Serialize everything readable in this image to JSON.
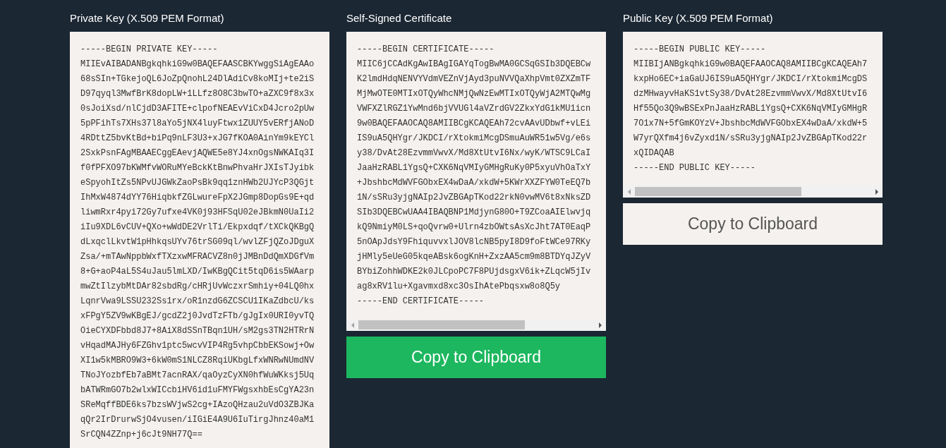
{
  "panels": [
    {
      "title": "Private Key (X.509 PEM Format)",
      "lines": [
        "-----BEGIN PRIVATE KEY-----",
        "MIIEvAIBADANBgkqhkiG9w0BAQEFAASCBKYwggSiAgEAAo",
        "68sSIn+TGkejoQL6JoZpQnohL24DlAdiCv8koMIj+te2iS",
        "D97qyql3MwfBrK8dopLW+1LLfz8O8C3bwTO+aZXC9f8x3x",
        "0sJoiXsd/nlCjdD3AFITE+clpofNEAEvViCxD4Jcro2pUw",
        "5pPFihTs7XHs37l8aYo5jNX4luyFtwx1ZUUY5vERfjANoD",
        "4RDttZ5bvKtBd+biPq9nLF3U3+xJG7fKOA0AinYm9kEYCl",
        "2SxkPsnFAgMBAAECggEAevjAQWE5e8YJ4xnOgsNWKAIq3I",
        "f0fPFXO97bKWMfvWORuMYeBckKtBnwPhvaHrJXIsTJyibk",
        "eSpyohItZs5NPvUJGWkZaoPsBk9qq1znHWb2UJYcP3QGjt",
        "IhMxW4874dYY76HiqbkfZGLwureFpX2JGmp8DopGs9E+qd",
        "liwmRxr4pyi72Gy7ufxe4VK0j93HFSqU02eJBkmN0UaIi2",
        "iIu9XDL6vCUV+QXo+wWdDE2VrlTi/Ekpxdqf/tXCkQKBgQ",
        "dLxqclLkvtW1pHhkqsUYv76trSG09ql/wvlZFjQZoJDguX",
        "Zsa/+mTAwNppbWxfTXzxwMFRACVZ8n0jJMBnDdQmXDGfVm",
        "8+G+aoP4aL5S4uJau5lmLXD/IwKBgQCit5tqD6is5WAarp",
        "mwZtIlzybMtDAr82sbdRg/cHRjUvWczxrSmhiy+04LQ0hx",
        "LqnrVwa9LSSU232Ss1rx/oR1nzdG6ZCSCU1IKaZdbcU/ks",
        "xFPgY5ZV9wKBgEJ/gcdZ2j0JvdTzFTb/gJgIx0URI0yvTQ",
        "OieCYXDFbbd8J7+8AiX8dSSnTBqn1UH/sM2gs3TN2HTRrN",
        "vHqadMAJHy6FZGhv1ptc5wcvVIP4Rg5vhpCbbEKSowj+Ow",
        "XI1w5kMBRO9W3+6kW0mS1NLCZ8RqiUKbgLfxWNRwNUmdNV",
        "TNoJYozbfEb7aBMt7acnRAX/qaOyzCyXN0hfWuWKksj5Uq",
        "bATWRmGO7b2wlxWICcbiHV6id1uFMYFWgsxhbEsCgYA23n",
        "SReMqffBDE6ks7bzsWVjwS2cg+IAzoQHzau2uVdO3ZBJKa",
        "qQr2IrDrurwSjO4vusen/iIGiE4A9U6IuTirgJhnz40aM1",
        "SrCQN4ZZnp+j6cJt9NH77Q=="
      ]
    },
    {
      "title": "Self-Signed Certificate",
      "horizontal_scrollbar": true,
      "lines": [
        "-----BEGIN CERTIFICATE-----",
        "MIIC6jCCAdKgAwIBAgIGAYqTogBwMA0GCSqGSIb3DQEBCw",
        "K2lmdHdqNENVYVdmVEZnVjAyd3puNVVQaXhpVmt0ZXZmTF",
        "MjMwOTE0MTIxOTQyWhcNMjQwNzEwMTIxOTQyWjA2MTQwMg",
        "VWFXZlRGZ1YwMnd6bjVVUGl4aVZrdGV2ZkxYdG1kMU1icn",
        "9w0BAQEFAAOCAQ8AMIIBCgKCAQEAh72cvAAvUDbwf+vLEi",
        "IS9uA5QHYgr/JKDCI/rXtokmiMcgDSmuAuWR51w5Vg/e6s",
        "y38/DvAt28EzvmmVwvX/Md8XtUtvI6Nx/wyK/WTSC9LCaI",
        "JaaHzRABL1YgsQ+CXK6NqVMIyGMHgRuKy0P5xyuVhOaTxY",
        "+JbshbcMdWVFGObxEX4wDaA/xkdW+5KWrXXZFYW0TeEQ7b",
        "1N/sSRu3yjgNAIp2JvZBGApTKod22rkN0vwMV6t8xNksZD",
        "SIb3DQEBCwUAA4IBAQBNP1MdjynG80O+T9ZCoaAIElwvjq",
        "kQ9NmiyM0LS+qoQvrw0+Ulrn4zbOWtsAsXcJht7AT0EaqP",
        "5nOApJdsY9FhiquvvxlJOV8lcNB5pyI8D9foFtWCe97RKy",
        "jHMly5eUeG05kqeABsk6ogKnH+ZxzAA5cm9m8BTDYqJZyV",
        "BYbiZohhWDKE2k0JLCpoPC7F8PUjdsgxV6ik+ZLqcW5jIv",
        "ag8xRV1lu+Xgavmxd8xc3OsIhAtePbqsxw8o8Q5y",
        "-----END CERTIFICATE-----"
      ],
      "button": {
        "label": "Copy to Clipboard",
        "primary": true
      }
    },
    {
      "title": "Public Key (X.509 PEM Format)",
      "horizontal_scrollbar": true,
      "lines": [
        "-----BEGIN PUBLIC KEY-----",
        "MIIBIjANBgkqhkiG9w0BAQEFAAOCAQ8AMIIBCgKCAQEAh7",
        "kxpHo6EC+iaGaUJ6IS9uA5QHYgr/JKDCI/rXtokmiMcgDS",
        "dzMHwayvHaKS1vtSy38/DvAt28EzvmmVwvX/Md8XtUtvI6",
        "Hf55Qo3Q9wBSExPnJaaHzRABL1YgsQ+CXK6NqVMIyGMHgR",
        "7O1x7N+5fGmKOYzV+JbshbcMdWVFGObxEX4wDaA/xkdW+5",
        "W7yrQXfm4j6vZyxd1N/sSRu3yjgNAIp2JvZBGApTKod22r",
        "xQIDAQAB",
        "-----END PUBLIC KEY-----"
      ],
      "button": {
        "label": "Copy to Clipboard",
        "primary": false
      }
    }
  ]
}
